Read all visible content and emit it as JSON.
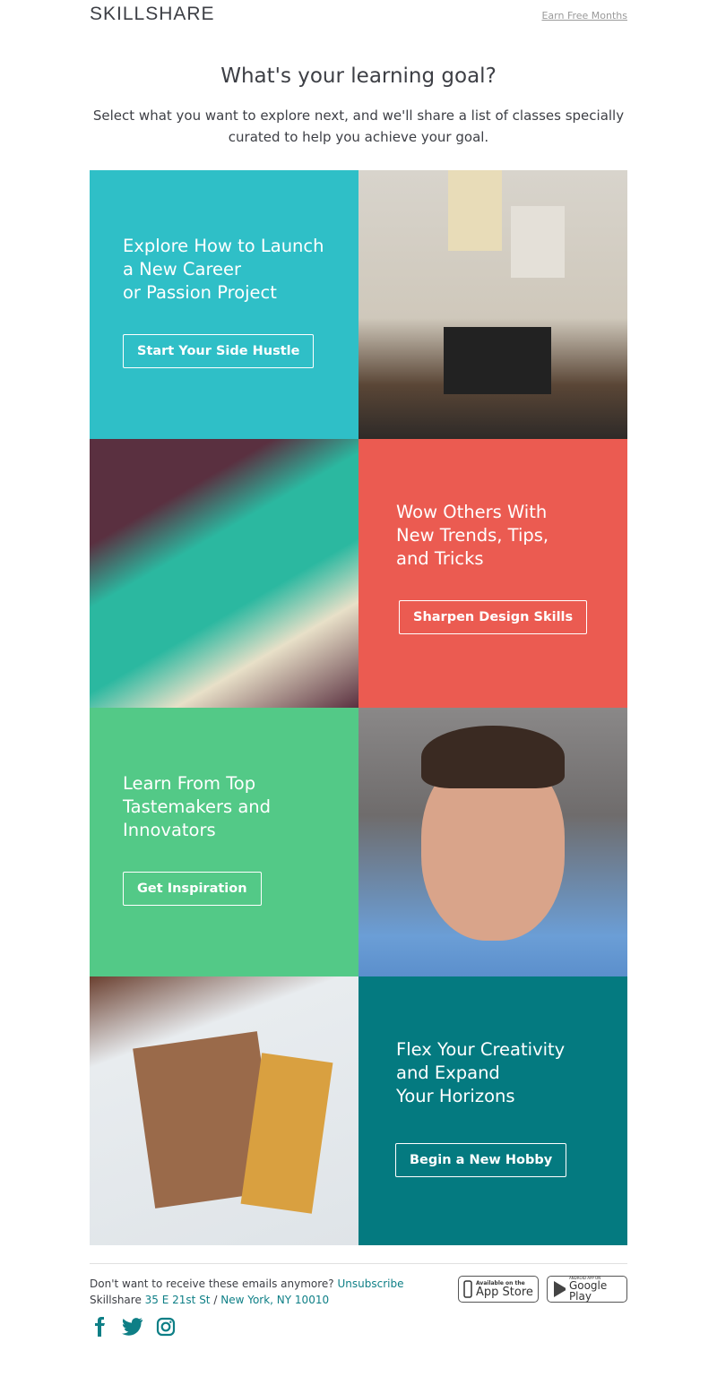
{
  "header": {
    "logo": "SKILLSHARE",
    "earn_link": "Earn Free Months"
  },
  "title": "What's your learning goal?",
  "subtitle": "Select what you want to explore next, and we'll share a list of classes specially curated to help you achieve your goal.",
  "tiles": [
    {
      "heading": "Explore How to Launch\na New Career\nor Passion Project",
      "button": "Start Your Side Hustle",
      "color": "#2fbfc7"
    },
    {
      "heading": "Wow Others With\nNew Trends, Tips,\nand Tricks",
      "button": "Sharpen Design Skills",
      "color": "#eb5b51"
    },
    {
      "heading": "Learn From Top\nTastemakers and\nInnovators",
      "button": "Get Inspiration",
      "color": "#53c987"
    },
    {
      "heading": "Flex Your Creativity\nand Expand\nYour Horizons",
      "button": "Begin a New Hobby",
      "color": "#047a80"
    }
  ],
  "footer": {
    "unsub_text": "Don't want to receive these emails anymore?",
    "unsub_link": "Unsubscribe",
    "company": "Skillshare",
    "street": "35 E 21st St",
    "sep": "/",
    "city": "New York, NY 10010",
    "app_store_small": "Available on the",
    "app_store": "App Store",
    "google_small": "ANDROID APP ON",
    "google": "Google Play"
  },
  "colors": {
    "link": "#0e7f86"
  }
}
